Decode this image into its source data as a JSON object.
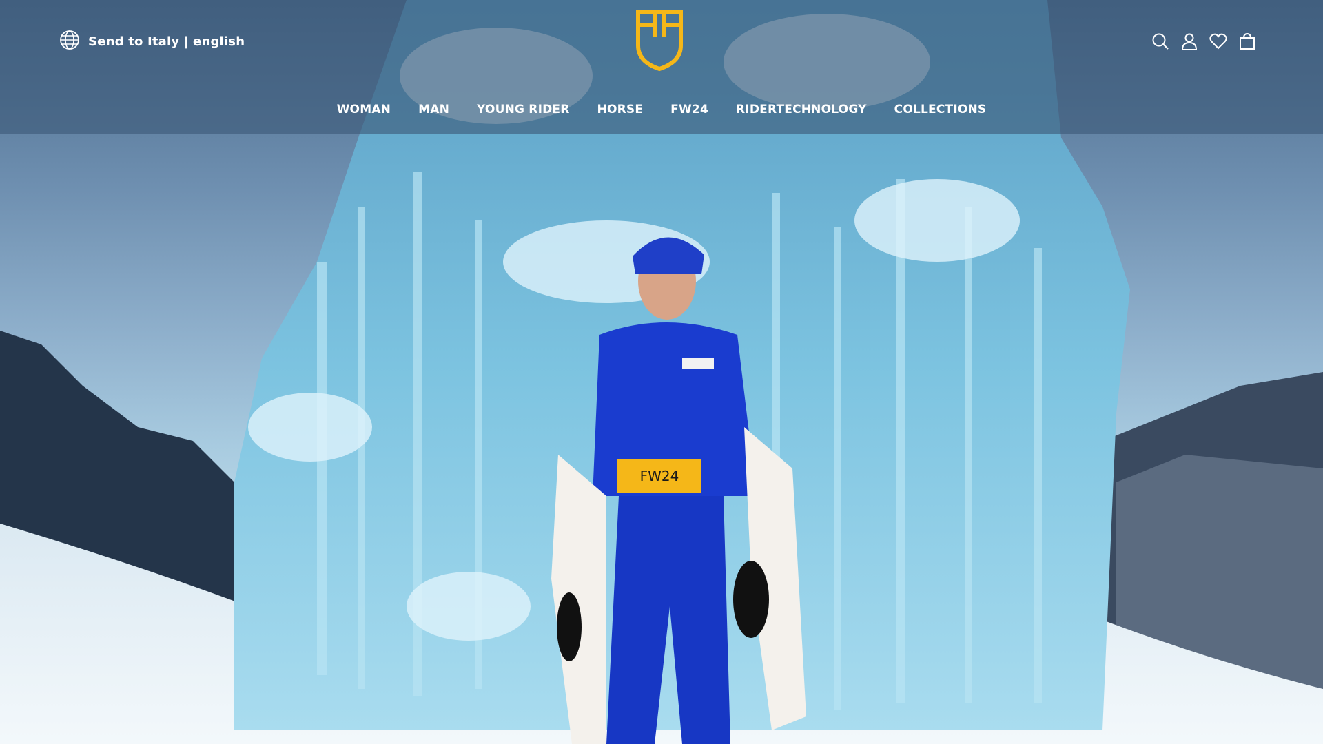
{
  "header": {
    "locale_label": "Send to Italy | english",
    "locale_icon": "globe-icon",
    "logo_icon": "brand-shield-logo",
    "accent_color": "#f5b718",
    "icons": [
      "search-icon",
      "account-icon",
      "wishlist-heart-icon",
      "shopping-bag-icon"
    ]
  },
  "nav": {
    "items": [
      {
        "label": "WOMAN"
      },
      {
        "label": "MAN"
      },
      {
        "label": "YOUNG RIDER"
      },
      {
        "label": "HORSE"
      },
      {
        "label": "FW24"
      },
      {
        "label": "RIDERTECHNOLOGY"
      },
      {
        "label": "COLLECTIONS"
      }
    ]
  },
  "hero": {
    "cta_label": "FW24",
    "cta_color": "#f5b718"
  }
}
